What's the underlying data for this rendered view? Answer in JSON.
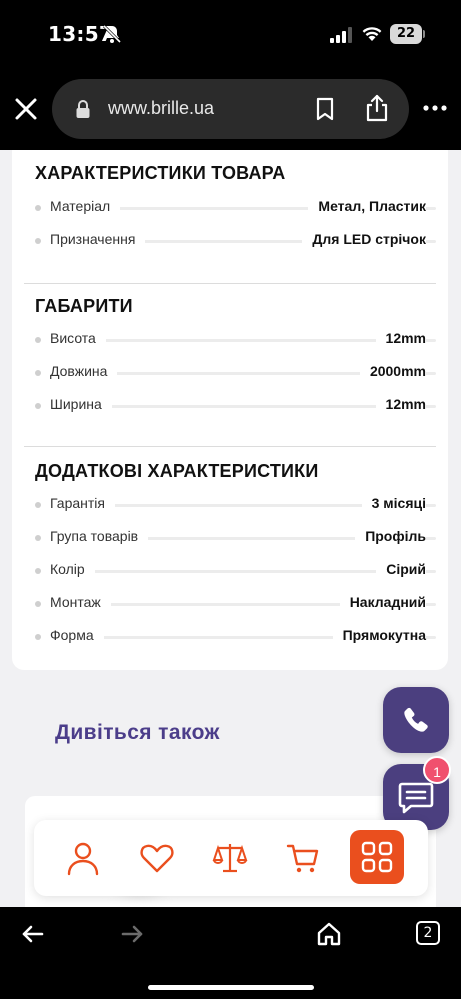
{
  "status_bar": {
    "time": "13:57",
    "battery": "22"
  },
  "browser": {
    "url": "www.brille.ua"
  },
  "sections": [
    {
      "title": "ХАРАКТЕРИСТИКИ ТОВАРА",
      "rows": [
        {
          "label": "Матеріал",
          "value": "Метал, Пластик"
        },
        {
          "label": "Призначення",
          "value": "Для LED стрічок"
        }
      ]
    },
    {
      "title": "ГАБАРИТИ",
      "rows": [
        {
          "label": "Висота",
          "value": "12mm"
        },
        {
          "label": "Довжина",
          "value": "2000mm"
        },
        {
          "label": "Ширина",
          "value": "12mm"
        }
      ]
    },
    {
      "title": "ДОДАТКОВІ ХАРАКТЕРИСТИКИ",
      "rows": [
        {
          "label": "Гарантія",
          "value": "3 місяці"
        },
        {
          "label": "Група товарів",
          "value": "Профіль"
        },
        {
          "label": "Колір",
          "value": "Сірий"
        },
        {
          "label": "Монтаж",
          "value": "Накладний"
        },
        {
          "label": "Форма",
          "value": "Прямокутна"
        }
      ]
    }
  ],
  "see_also": "Дивіться також",
  "chat_badge": "1",
  "tabs_count": "2",
  "colors": {
    "accent_orange": "#ea4f1e",
    "fab_purple": "#4b3f7f",
    "heading_purple": "#4b3d8a"
  }
}
